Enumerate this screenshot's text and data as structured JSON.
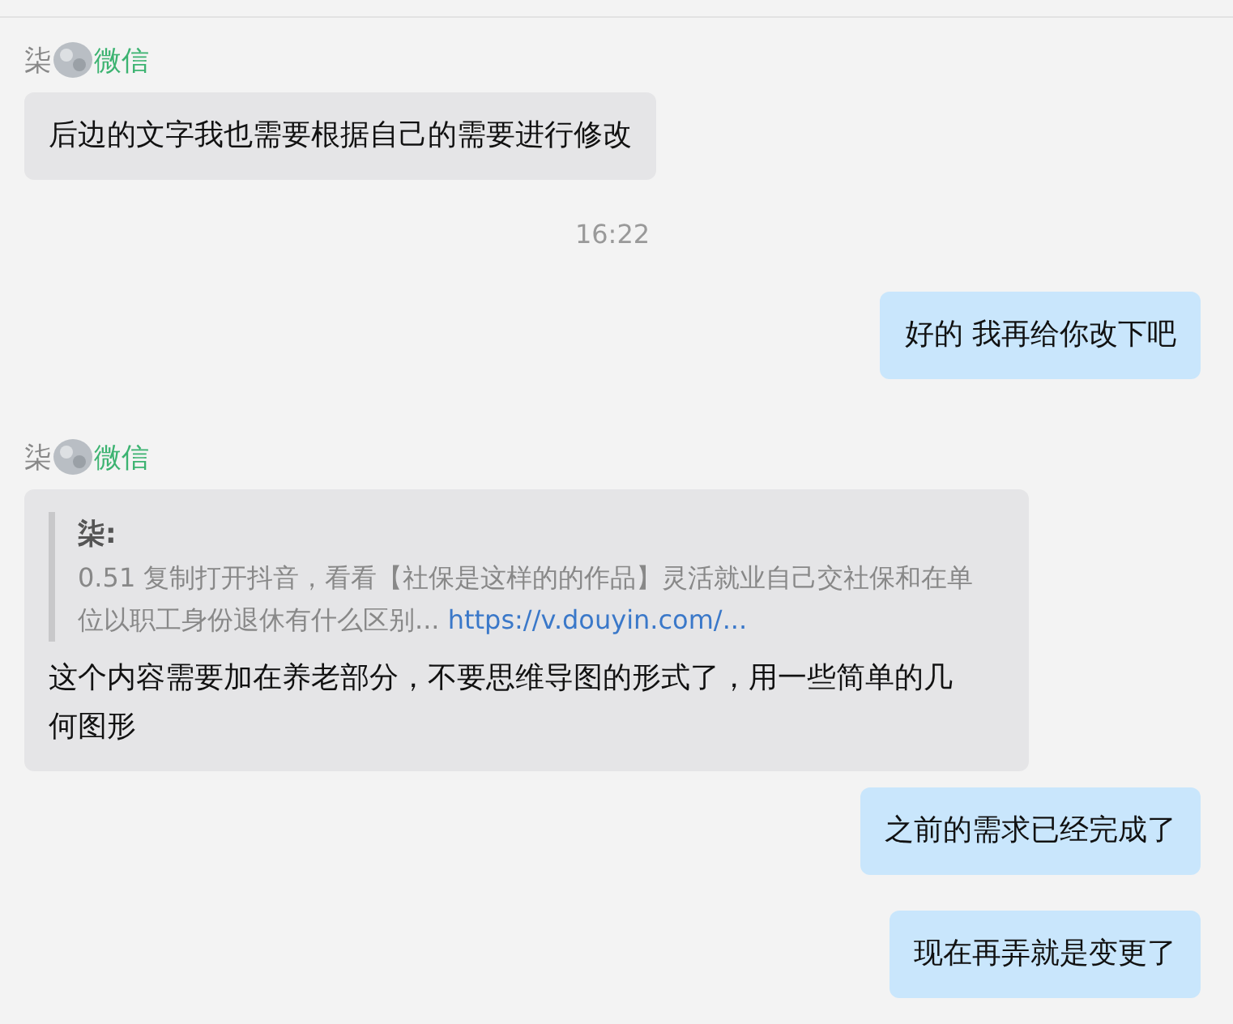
{
  "messages": [
    {
      "kind": "incoming",
      "sender": "柒",
      "app_tag": "微信",
      "text": "后边的文字我也需要根据自己的需要进行修改"
    },
    {
      "kind": "time",
      "text": "16:22"
    },
    {
      "kind": "outgoing",
      "text": "好的 我再给你改下吧"
    },
    {
      "kind": "incoming",
      "sender": "柒",
      "app_tag": "微信",
      "quote": {
        "author": "柒:",
        "text": "0.51 复制打开抖音，看看【社保是这样的的作品】灵活就业自己交社保和在单位以职工身份退休有什么区别...",
        "link": "https://v.douyin.com/..."
      },
      "text": "这个内容需要加在养老部分，不要思维导图的形式了，用一些简单的几何图形"
    },
    {
      "kind": "outgoing",
      "text": "之前的需求已经完成了"
    },
    {
      "kind": "outgoing",
      "text": "现在再弄就是变更了"
    }
  ]
}
